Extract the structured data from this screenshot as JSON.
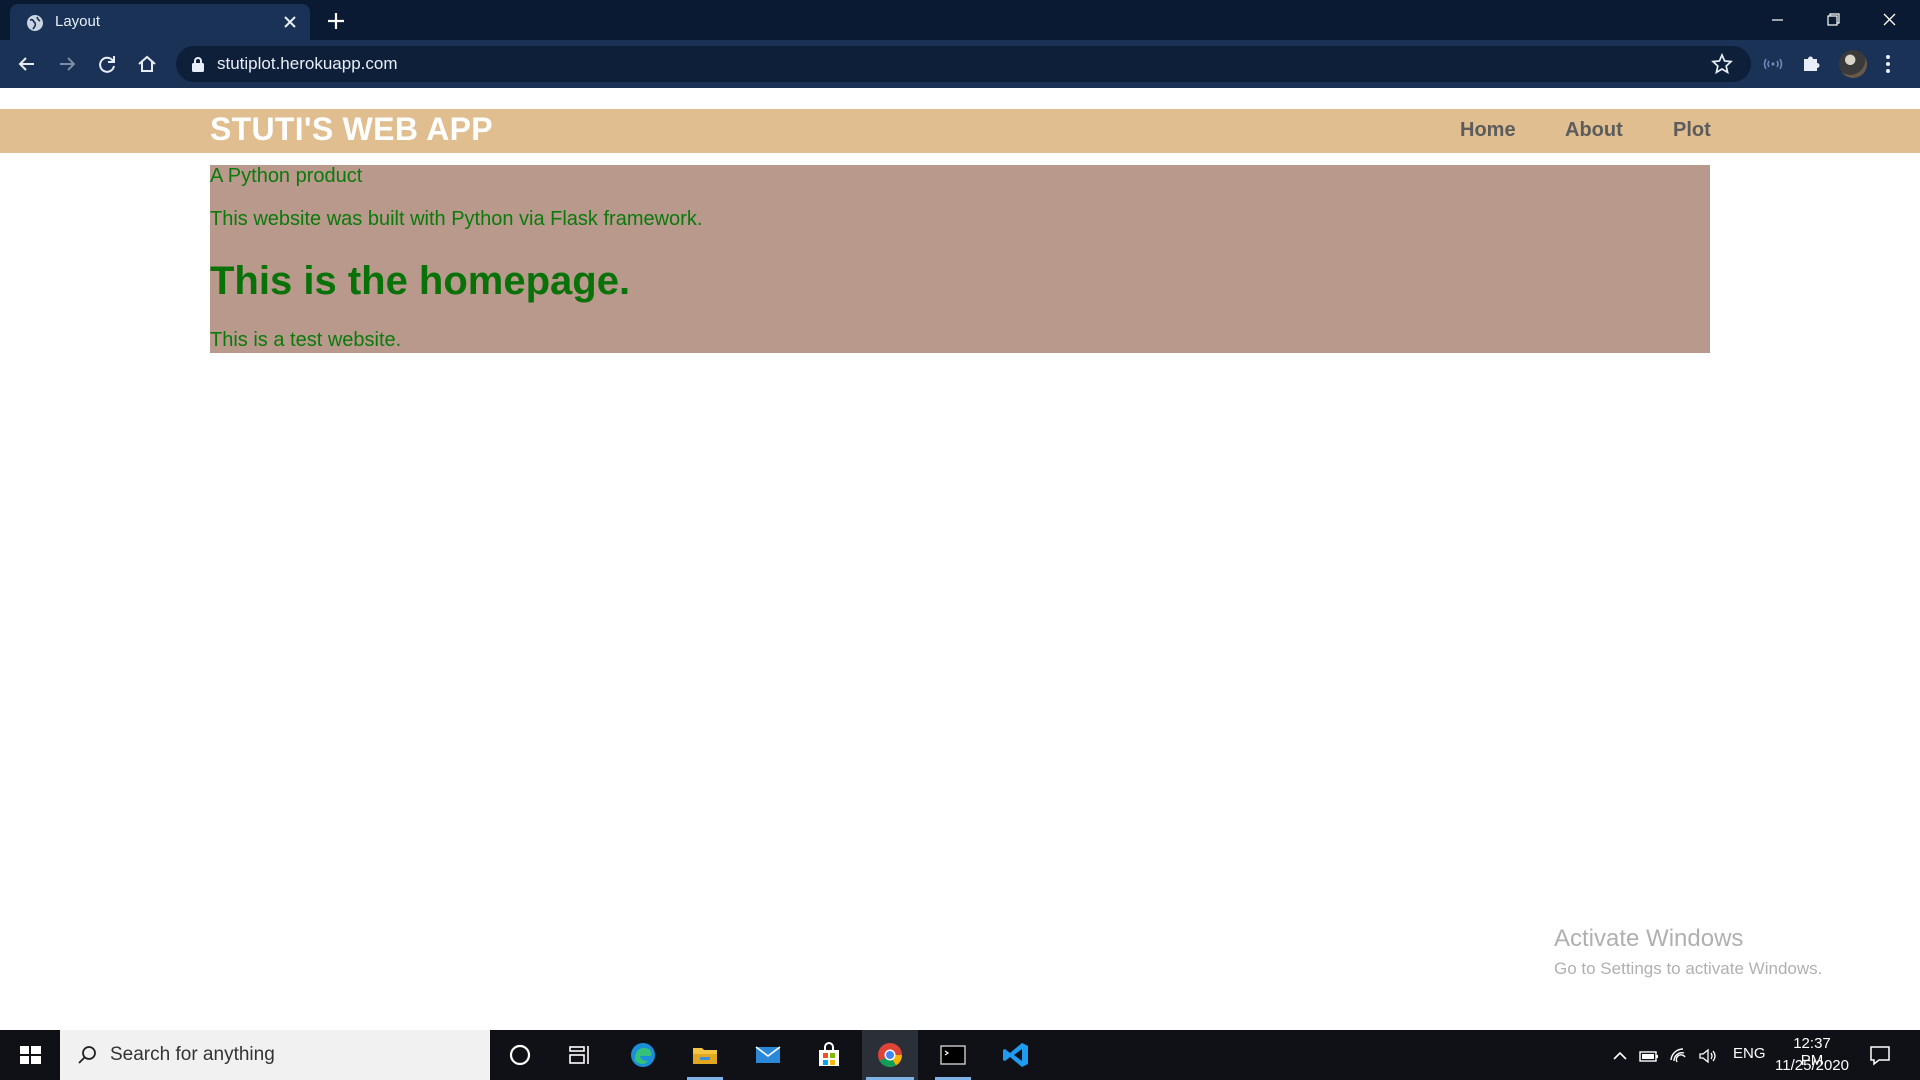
{
  "browser": {
    "tab_title": "Layout",
    "url": "stutiplot.herokuapp.com"
  },
  "site": {
    "title": "STUTI'S WEB APP",
    "nav": {
      "home": "Home",
      "about": "About",
      "plot": "Plot"
    },
    "tagline": "A Python product",
    "built_with": "This website was built with Python via Flask framework.",
    "heading": "This is the homepage.",
    "test_text": "This is a test website.",
    "colors": {
      "header_bg": "#e1be90",
      "content_bg": "#b8998c",
      "content_text": "#0a7a0a"
    }
  },
  "watermark": {
    "title": "Activate Windows",
    "subtitle": "Go to Settings to activate Windows."
  },
  "taskbar": {
    "search_placeholder": "Search for anything",
    "apps": [
      "cortana-icon",
      "task-view-icon",
      "edge-icon",
      "file-explorer-icon",
      "mail-icon",
      "store-icon",
      "chrome-icon",
      "terminal-icon",
      "vscode-icon"
    ],
    "language": "ENG",
    "time": "12:37 PM",
    "date": "11/25/2020"
  }
}
